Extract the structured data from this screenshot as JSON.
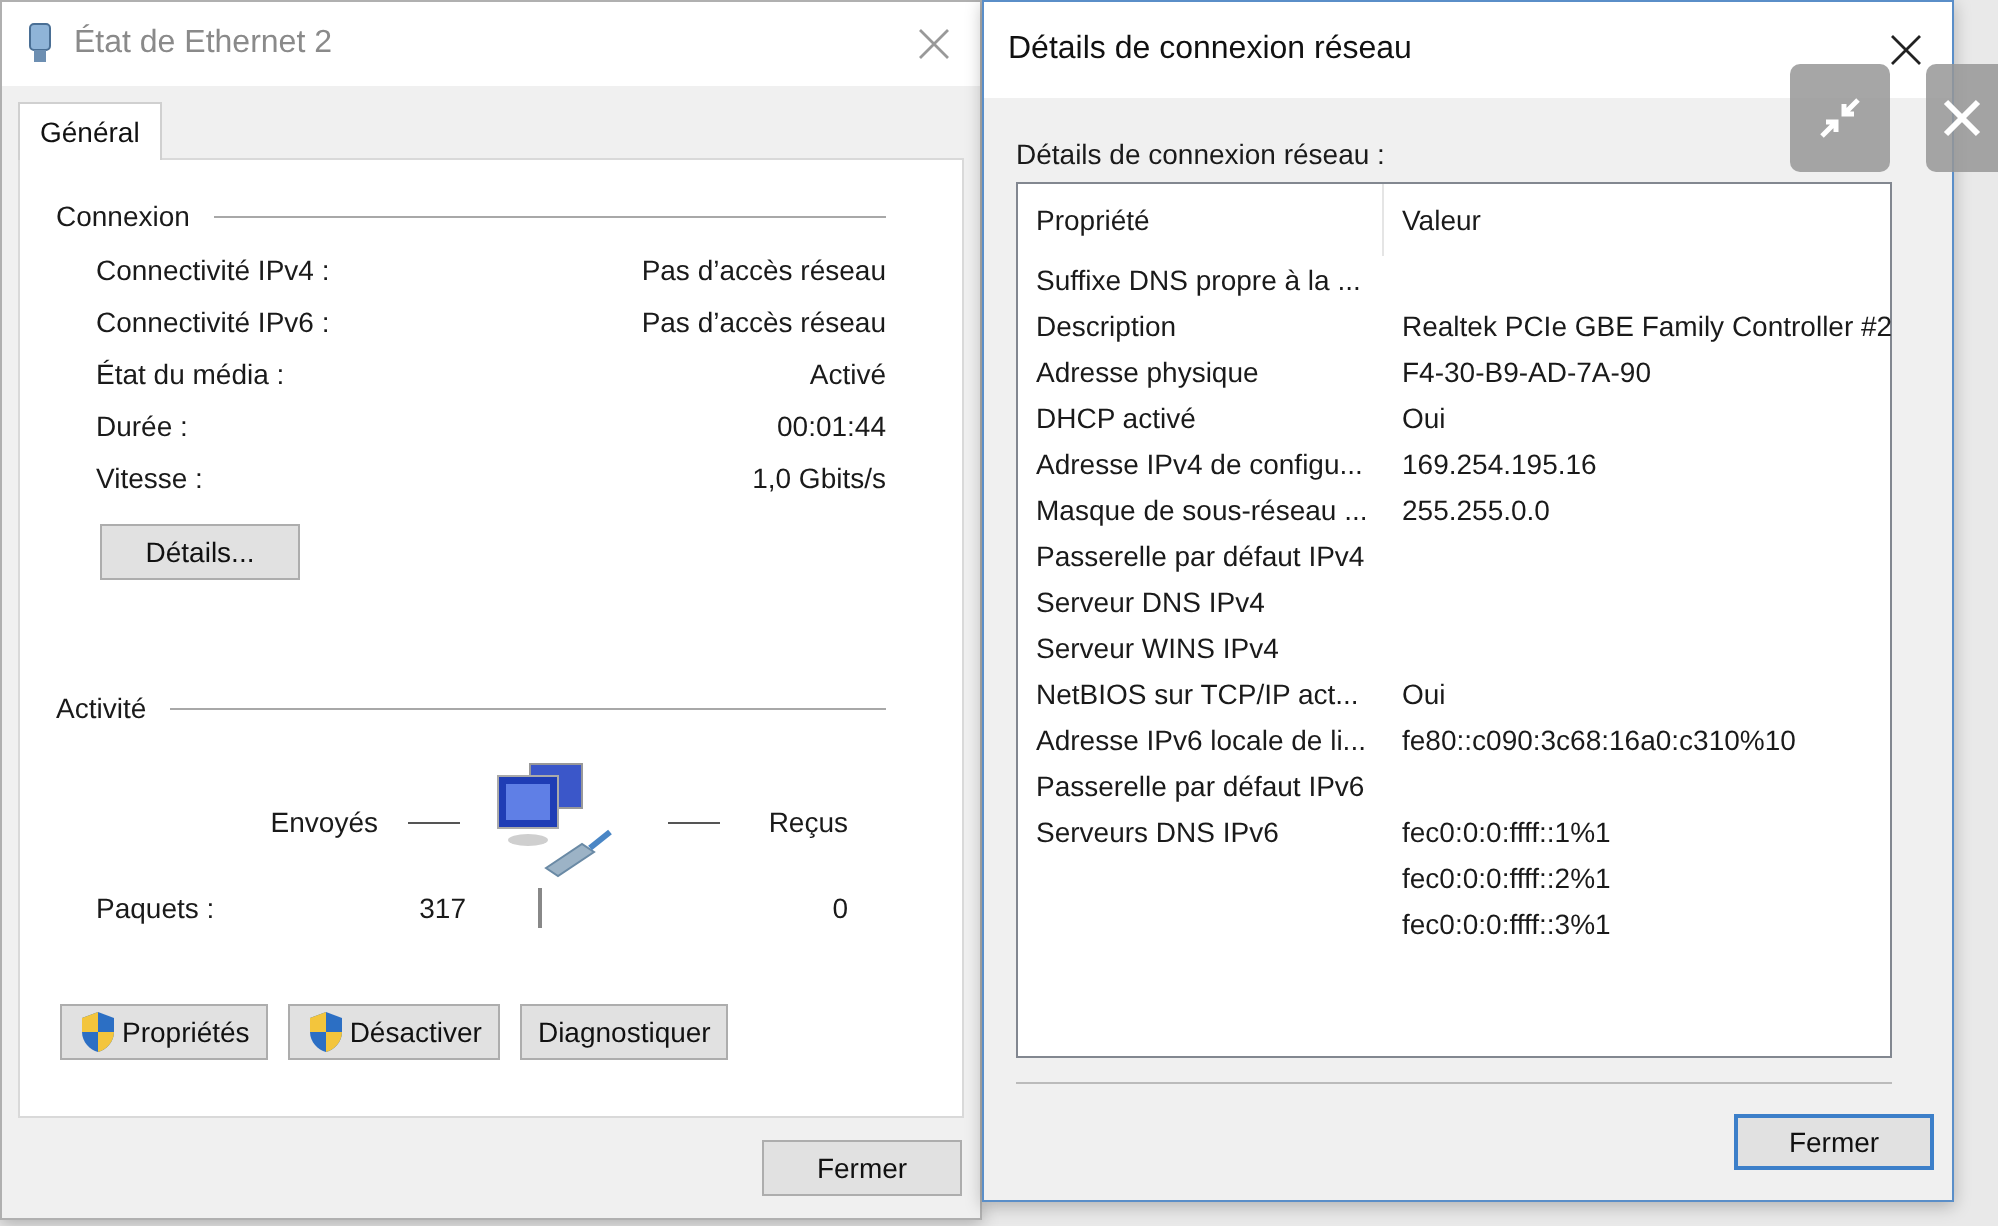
{
  "status_window": {
    "title": "État de Ethernet 2",
    "active": false,
    "tabs": [
      {
        "label": "Général",
        "selected": true
      }
    ],
    "connection": {
      "heading": "Connexion",
      "rows": [
        {
          "label": "Connectivité IPv4 :",
          "value": "Pas d’accès réseau"
        },
        {
          "label": "Connectivité IPv6 :",
          "value": "Pas d’accès réseau"
        },
        {
          "label": "État du média :",
          "value": "Activé"
        },
        {
          "label": "Durée :",
          "value": "00:01:44"
        },
        {
          "label": "Vitesse :",
          "value": "1,0 Gbits/s"
        }
      ],
      "details_button": "Détails..."
    },
    "activity": {
      "heading": "Activité",
      "sent_label": "Envoyés",
      "received_label": "Reçus",
      "packets_label": "Paquets :",
      "packets_sent": "317",
      "packets_received": "0"
    },
    "buttons": [
      {
        "label": "Propriétés",
        "shield": true
      },
      {
        "label": "Désactiver",
        "shield": true
      },
      {
        "label": "Diagnostiquer",
        "shield": false
      }
    ],
    "close_button": "Fermer"
  },
  "details_window": {
    "title": "Détails de connexion réseau",
    "active": true,
    "caption": "Détails de connexion réseau :",
    "columns": [
      "Propriété",
      "Valeur"
    ],
    "rows": [
      {
        "property": "Suffixe DNS propre à la ..."
      },
      {
        "property": "Description",
        "values": [
          "Realtek PCIe GBE Family Controller #2"
        ]
      },
      {
        "property": "Adresse physique",
        "values": [
          "F4-30-B9-AD-7A-90"
        ]
      },
      {
        "property": "DHCP activé",
        "values": [
          "Oui"
        ]
      },
      {
        "property": "Adresse IPv4 de configu...",
        "values": [
          "169.254.195.16"
        ]
      },
      {
        "property": "Masque de sous-réseau ...",
        "values": [
          "255.255.0.0"
        ]
      },
      {
        "property": "Passerelle par défaut IPv4"
      },
      {
        "property": "Serveur DNS IPv4"
      },
      {
        "property": "Serveur WINS IPv4"
      },
      {
        "property": "NetBIOS sur TCP/IP act...",
        "values": [
          "Oui"
        ]
      },
      {
        "property": "Adresse IPv6 locale de li...",
        "values": [
          "fe80::c090:3c68:16a0:c310%10"
        ]
      },
      {
        "property": "Passerelle par défaut IPv6"
      },
      {
        "property": "Serveurs DNS IPv6",
        "values": [
          "fec0:0:0:ffff::1%1",
          "fec0:0:0:ffff::2%1",
          "fec0:0:0:ffff::3%1"
        ]
      }
    ],
    "close_button": "Fermer"
  }
}
